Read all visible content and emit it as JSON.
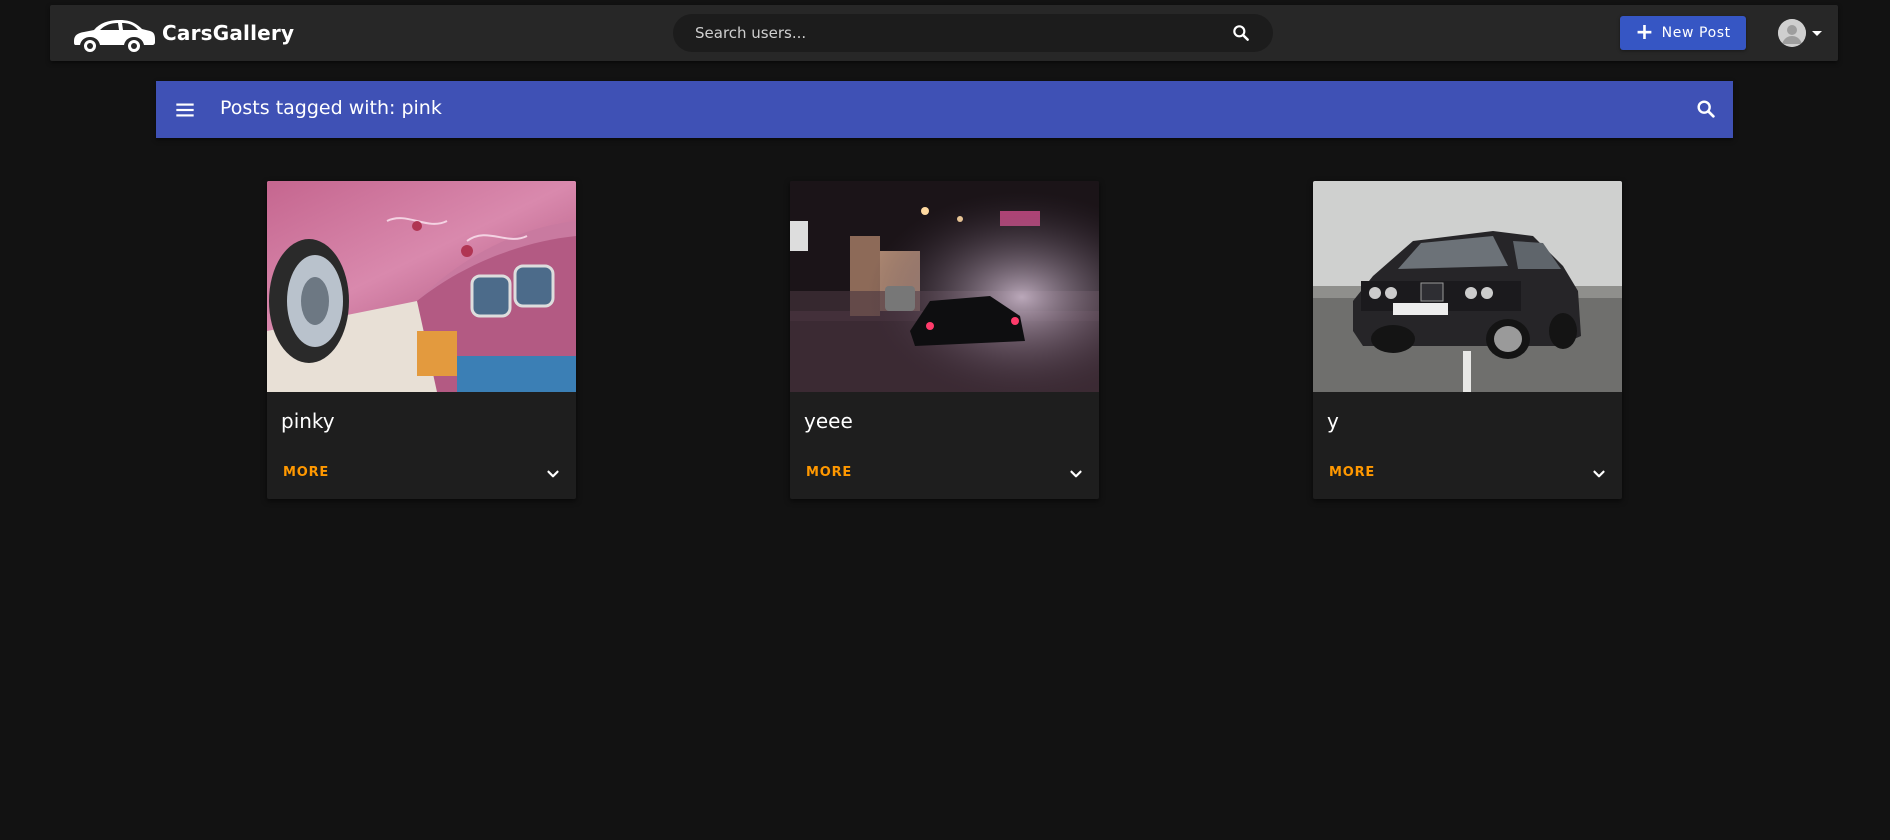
{
  "app": {
    "brand_name": "CarsGallery",
    "logo_icon": "car-logo-icon"
  },
  "topbar": {
    "search_placeholder": "Search users...",
    "search_icon": "search-icon",
    "new_post_label": "New Post",
    "new_post_icon": "plus-icon",
    "avatar_icon": "user-avatar-icon",
    "avatar_menu_icon": "caret-down-icon"
  },
  "subbar": {
    "title": "Posts tagged with: pink",
    "menu_icon": "menu-icon",
    "search_icon": "search-icon"
  },
  "posts": [
    {
      "title": "pinky",
      "more_label": "MORE",
      "expand_icon": "chevron-down-icon"
    },
    {
      "title": "yeee",
      "more_label": "MORE",
      "expand_icon": "chevron-down-icon"
    },
    {
      "title": "y",
      "more_label": "MORE",
      "expand_icon": "chevron-down-icon"
    }
  ],
  "colors": {
    "background": "#121212",
    "topbar": "#272727",
    "subbar": "#3f51b5",
    "new_post_button": "#3656c4",
    "card": "#1e1e1e",
    "more_link": "#ff9800"
  }
}
